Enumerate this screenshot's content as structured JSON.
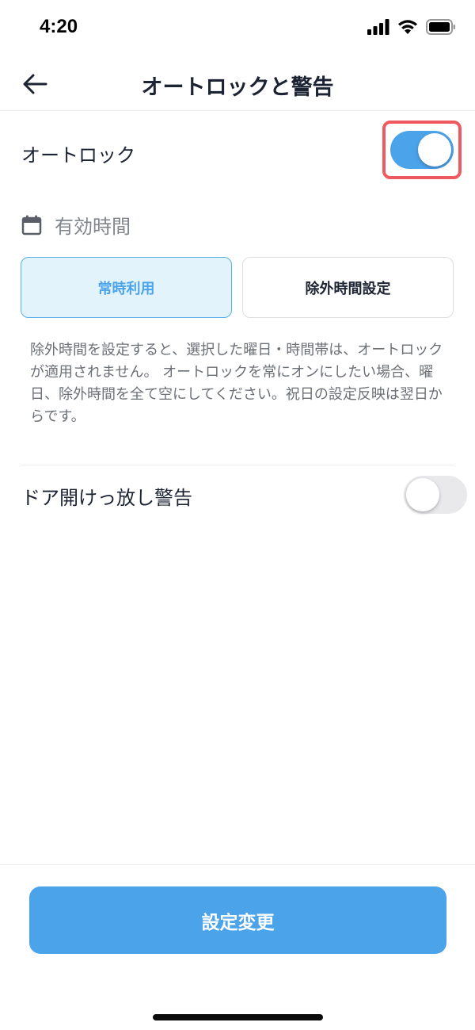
{
  "status_bar": {
    "time": "4:20",
    "icons": [
      "signal-icon",
      "wifi-icon",
      "battery-icon"
    ]
  },
  "header": {
    "back_icon": "arrow-left-icon",
    "title": "オートロックと警告"
  },
  "autolock": {
    "label": "オートロック",
    "enabled": true
  },
  "valid_time": {
    "icon": "calendar-icon",
    "label": "有効時間",
    "segments": [
      {
        "label": "常時利用",
        "selected": true
      },
      {
        "label": "除外時間設定",
        "selected": false
      }
    ],
    "description": "除外時間を設定すると、選択した曜日・時間帯は、オートロックが適用されません。 オートロックを常にオンにしたい場合、曜日、除外時間を全て空にしてください。祝日の設定反映は翌日からです。"
  },
  "door_alert": {
    "label": "ドア開けっ放し警告",
    "enabled": false
  },
  "footer": {
    "submit_label": "設定変更"
  },
  "colors": {
    "accent": "#4ba3ea",
    "highlight": "#ee5a5f",
    "text": "#1c2333",
    "muted": "#6b6f76"
  }
}
